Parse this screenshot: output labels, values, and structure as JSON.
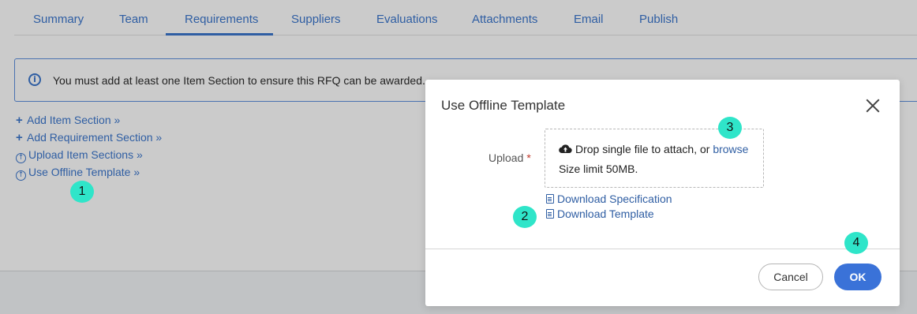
{
  "tabs": [
    {
      "label": "Summary"
    },
    {
      "label": "Team"
    },
    {
      "label": "Requirements",
      "active": true
    },
    {
      "label": "Suppliers"
    },
    {
      "label": "Evaluations"
    },
    {
      "label": "Attachments"
    },
    {
      "label": "Email"
    },
    {
      "label": "Publish"
    }
  ],
  "info": {
    "icon": "info-icon",
    "text": "You must add at least one Item Section to ensure this RFQ can be awarded."
  },
  "actions": [
    {
      "label": "Add Item Section »",
      "icon": "plus-icon"
    },
    {
      "label": "Add Requirement Section »",
      "icon": "plus-icon"
    },
    {
      "label": "Upload Item Sections »",
      "icon": "upload-icon"
    },
    {
      "label": "Use Offline Template »",
      "icon": "upload-icon"
    }
  ],
  "markers": [
    "1",
    "2",
    "3",
    "4"
  ],
  "modal": {
    "title": "Use Offline Template",
    "upload_label": "Upload",
    "required_mark": "*",
    "drop_text": "Drop single file to attach, or",
    "browse": "browse",
    "size_limit": "Size limit 50MB.",
    "download_spec": "Download Specification",
    "download_template": "Download Template",
    "cancel": "Cancel",
    "ok": "OK"
  },
  "colors": {
    "accent": "#2f5ea3",
    "ok_button": "#3a72d8",
    "marker": "#2fe5c9",
    "overlay_background": "#cbcbcb"
  }
}
